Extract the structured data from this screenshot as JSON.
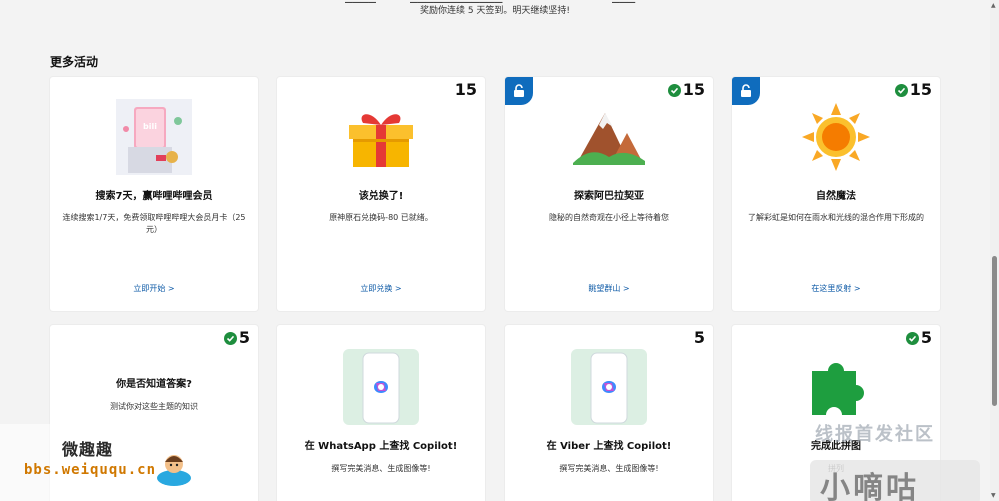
{
  "top": {
    "streak_text": "奖励你连续 5 天签到。明天继续坚持!"
  },
  "section": {
    "title": "更多活动"
  },
  "cards": [
    {
      "id": "bilibili",
      "points": "",
      "completed": false,
      "locked": false,
      "icon": "bilibili-membership-card-icon",
      "title": "搜索7天，赢哔哩哔哩会员",
      "desc": "连续搜索1/7天，免费领取哔哩哔哩大会员月卡（25元）",
      "link": "立即开始 >"
    },
    {
      "id": "gift",
      "points": "15",
      "completed": false,
      "locked": false,
      "icon": "gift-box-icon",
      "title": "该兑换了!",
      "desc": "原神原石兑换码-80 已就绪。",
      "link": "立即兑换 >"
    },
    {
      "id": "abala",
      "points": "15",
      "completed": true,
      "locked": true,
      "icon": "mountain-icon",
      "title": "探索阿巴拉契亚",
      "desc": "隐秘的自然奇观在小径上等待着您",
      "link": "眺望群山 >"
    },
    {
      "id": "nature",
      "points": "15",
      "completed": true,
      "locked": true,
      "icon": "sun-icon",
      "title": "自然魔法",
      "desc": "了解彩虹是如何在雨水和光线的混合作用下形成的",
      "link": "在这里反射 >"
    },
    {
      "id": "quiz",
      "points": "5",
      "completed": true,
      "locked": false,
      "icon": "",
      "title": "你是否知道答案?",
      "desc": "测试你对这些主题的知识",
      "link": ""
    },
    {
      "id": "whatsapp",
      "points": "",
      "completed": false,
      "locked": false,
      "icon": "phone-copilot-icon",
      "title": "在 WhatsApp 上查找 Copilot!",
      "desc": "撰写完美消息、生成图像等!",
      "link": ""
    },
    {
      "id": "viber",
      "points": "5",
      "completed": false,
      "locked": false,
      "icon": "phone-copilot-icon",
      "title": "在 Viber 上查找 Copilot!",
      "desc": "撰写完美消息、生成图像等!",
      "link": ""
    },
    {
      "id": "puzzle",
      "points": "5",
      "completed": true,
      "locked": false,
      "icon": "puzzle-piece-icon",
      "title": "完成此拼图",
      "desc": "拼列",
      "link": ""
    }
  ],
  "watermarks": {
    "left_title": "微趣趣",
    "left_url": "bbs.weiququ.cn",
    "right_line1": "线报首发社区",
    "right_line2": "小嘀咕"
  },
  "colors": {
    "accent": "#0f6cbd",
    "check": "#1e8e3e",
    "link": "#0f5ba7",
    "background": "#f3f3f3"
  }
}
